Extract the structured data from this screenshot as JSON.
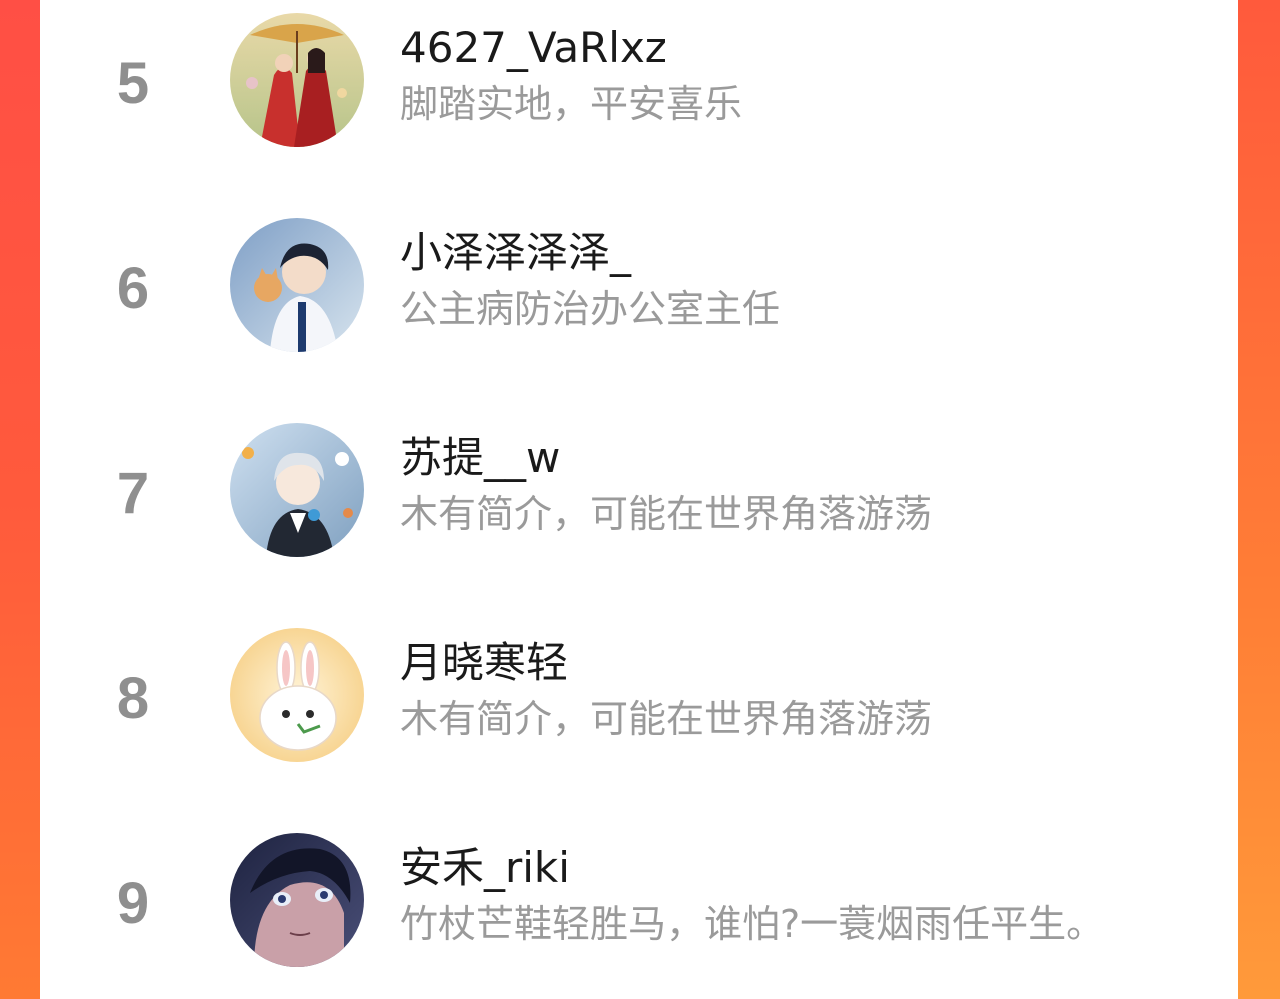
{
  "colors": {
    "background_accent": "#ff5a3c",
    "rank_text": "#8f8f8f",
    "name_text": "#1a1a1a",
    "bio_text": "#9a9a9a"
  },
  "ranking": [
    {
      "rank": "5",
      "name": "4627_VaRlxz",
      "bio": "脚踏实地，平安喜乐",
      "avatar": "illustrated-couple-avatar"
    },
    {
      "rank": "6",
      "name": "小泽泽泽泽_",
      "bio": "公主病防治办公室主任",
      "avatar": "illustrated-boy-with-cat-avatar"
    },
    {
      "rank": "7",
      "name": "苏提__w",
      "bio": "木有简介，可能在世界角落游荡",
      "avatar": "illustrated-silver-hair-avatar"
    },
    {
      "rank": "8",
      "name": "月晓寒轻",
      "bio": "木有简介，可能在世界角落游荡",
      "avatar": "white-rabbit-avatar"
    },
    {
      "rank": "9",
      "name": "安禾_riki",
      "bio": "竹杖芒鞋轻胜马，谁怕?一蓑烟雨任平生。",
      "avatar": "dark-portrait-avatar"
    }
  ]
}
